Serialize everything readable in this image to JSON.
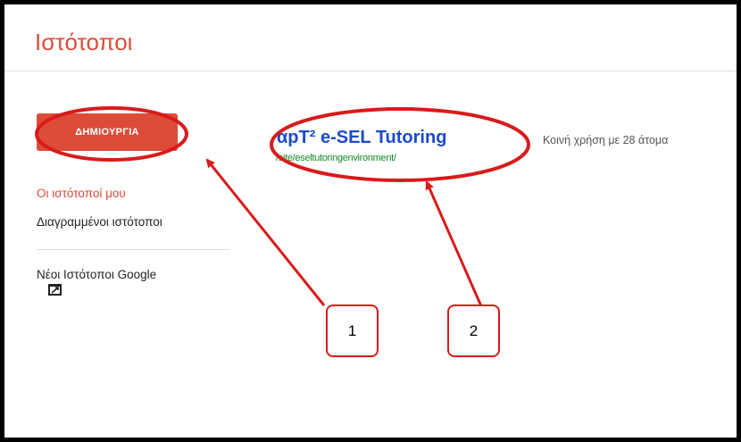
{
  "header": {
    "title": "Ιστότοποι"
  },
  "sidebar": {
    "create_label": "ΔΗΜΙΟΥΡΓΙΑ",
    "items": [
      {
        "label": "Οι ιστότοποί μου"
      },
      {
        "label": "Διαγραμμένοι ιστότοποι"
      },
      {
        "label": "Νέοι Ιστότοποι Google"
      }
    ]
  },
  "site": {
    "title": "αpT² e-SEL Tutoring",
    "url": "/site/eseltutoringenvironment/",
    "shared": "Κοινή χρήση με 28 άτομα"
  },
  "annotations": {
    "callout_1": "1",
    "callout_2": "2",
    "color": "#d81b1b"
  },
  "colors": {
    "accent": "#dd4b39",
    "link": "#1a4bc9",
    "url": "#148a2b"
  }
}
